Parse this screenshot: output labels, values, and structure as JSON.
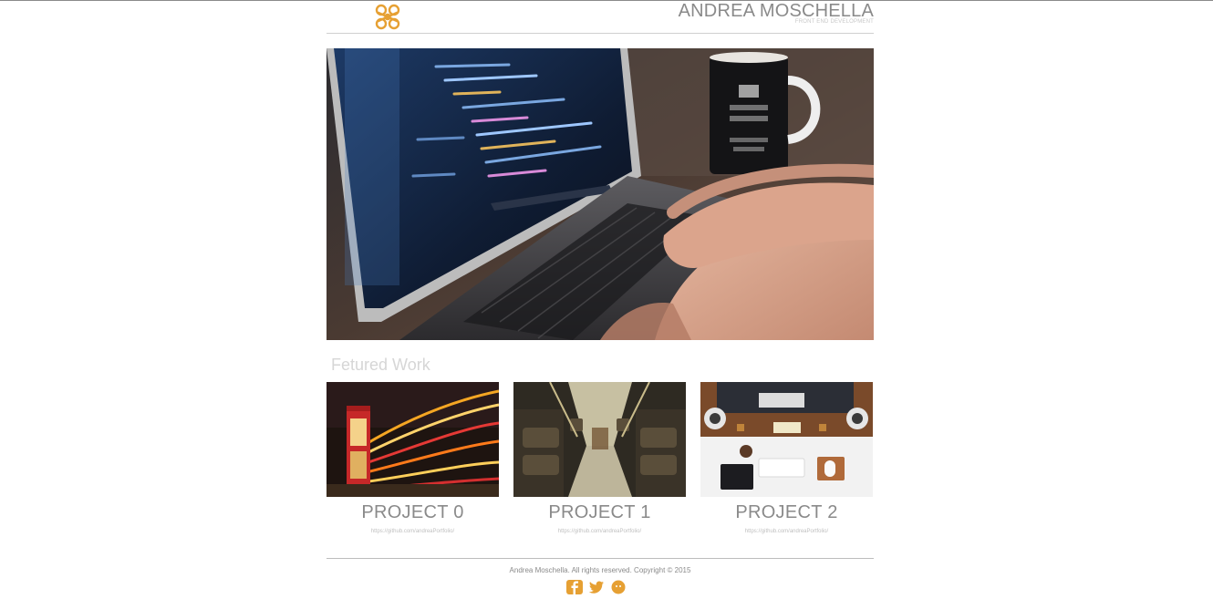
{
  "header": {
    "title": "ANDREA MOSCHELLA",
    "subtitle": "FRONT END DEVELOPMENT",
    "logo_icon": "knot-logo-icon",
    "accent_color": "#e6a033"
  },
  "hero": {
    "image": "laptop-coding-photo"
  },
  "featured": {
    "title": "Fetured Work",
    "projects": [
      {
        "name": "PROJECT 0",
        "url": "https://github.com/andreaPortfolio/",
        "image": "red-phone-booth-night-photo"
      },
      {
        "name": "PROJECT 1",
        "url": "https://github.com/andreaPortfolio/",
        "image": "bus-interior-photo"
      },
      {
        "name": "PROJECT 2",
        "url": "https://github.com/andreaPortfolio/",
        "image": "desk-setup-photo"
      }
    ]
  },
  "footer": {
    "copyright": "Andrea Moschella. All rights reserved. Copyright © 2015",
    "social_icons": [
      "facebook-icon",
      "twitter-icon",
      "github-icon"
    ]
  }
}
